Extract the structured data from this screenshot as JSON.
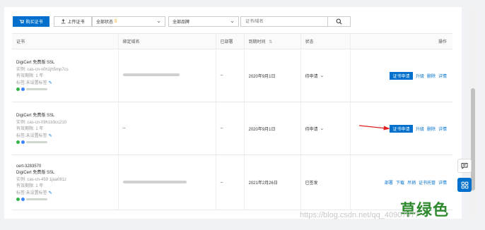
{
  "toolbar": {
    "buy_label": "购买证书",
    "upload_label": "上传证书",
    "status_select": {
      "value": "全部状态",
      "count": "5"
    },
    "brand_select": {
      "value": "全部品牌"
    },
    "search_placeholder": "证书/域名"
  },
  "table": {
    "headers": {
      "cert": "证书",
      "domain": "绑定域名",
      "deployed": "已部署",
      "expiry": "到期时间",
      "status": "状态",
      "ops": "操作"
    },
    "rows": [
      {
        "id_line": "",
        "name": "DigiCert 免费版 SSL",
        "instance": "实例: cas-cn-x0h1jh5mp7cs",
        "period": "有效期限: 1 年",
        "tag_label": "标签:未设置标签",
        "domain": "",
        "deployed": "--",
        "expiry": "2020年9月1日",
        "status": "待申请",
        "apply_label": "证书申请",
        "links": [
          "升级",
          "删除",
          "详情"
        ]
      },
      {
        "id_line": "",
        "name": "DigiCert 免费版 SSL",
        "instance": "实例: cas-cn-09h1b3cc210",
        "period": "有效期限: 1 年",
        "tag_label": "标签:未设置标签",
        "domain": "--",
        "deployed": "--",
        "expiry": "2020年9月1日",
        "status": "待申请",
        "apply_label": "证书申请",
        "links": [
          "升级",
          "删除",
          "详情"
        ]
      },
      {
        "id_line": "cert-3283570",
        "name": "DigiCert 免费版 SSL",
        "instance": "实例: cas-cn-459 1jaa081z",
        "period": "有效期限: 1 年",
        "tag_label": "标签:未设置标签",
        "domain": "",
        "deployed": "--",
        "expiry": "2021年2月26日",
        "status": "已签发",
        "apply_label": "",
        "links": [
          "部署",
          "下载",
          "吊销",
          "证书托管",
          "详情"
        ]
      }
    ]
  },
  "overlay": {
    "green_text": "草绿色",
    "watermark": "https://blog.csdn.net/qq_40907977"
  },
  "colors": {
    "primary": "#0070cc",
    "arrow": "#e02020",
    "green_text": "#2f8a2f"
  }
}
